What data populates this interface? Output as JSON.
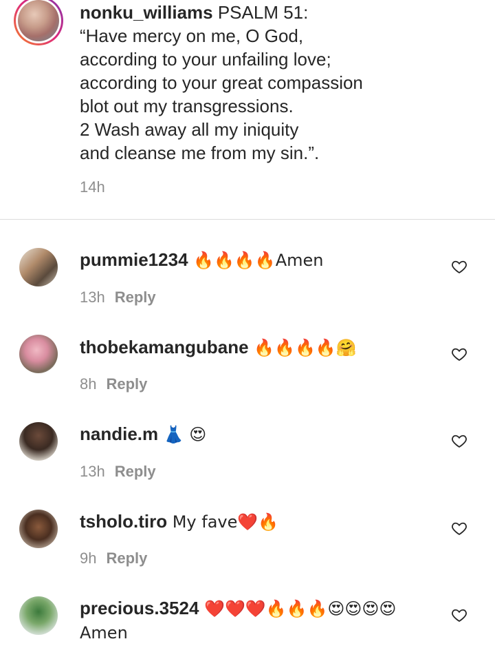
{
  "caption": {
    "username": "nonku_williams",
    "text": " PSALM 51:\n“Have mercy on me, O God,\naccording to your unfailing love;\naccording to your great compassion\nblot out my transgressions.\n2 Wash away all my iniquity\nand cleanse me from my sin.”.",
    "time": "14h"
  },
  "comments": [
    {
      "username": "pummie1234",
      "text": " 🔥🔥🔥🔥Amen",
      "time": "13h",
      "reply": "Reply"
    },
    {
      "username": "thobekamangubane",
      "text": " 🔥🔥🔥🔥🤗",
      "time": "8h",
      "reply": "Reply"
    },
    {
      "username": "nandie.m",
      "text": " 👗 😍",
      "time": "13h",
      "reply": "Reply"
    },
    {
      "username": "tsholo.tiro",
      "text": " My fave❤️🔥",
      "time": "9h",
      "reply": "Reply"
    },
    {
      "username": "precious.3524",
      "text": " ❤️❤️❤️🔥🔥🔥😍😍😍😍\nAmen",
      "time": "",
      "reply": ""
    }
  ],
  "colors": {
    "text": "#262626",
    "muted": "#8e8e8e",
    "divider": "#dbdbdb",
    "story_ring": "#dd2a7b"
  }
}
